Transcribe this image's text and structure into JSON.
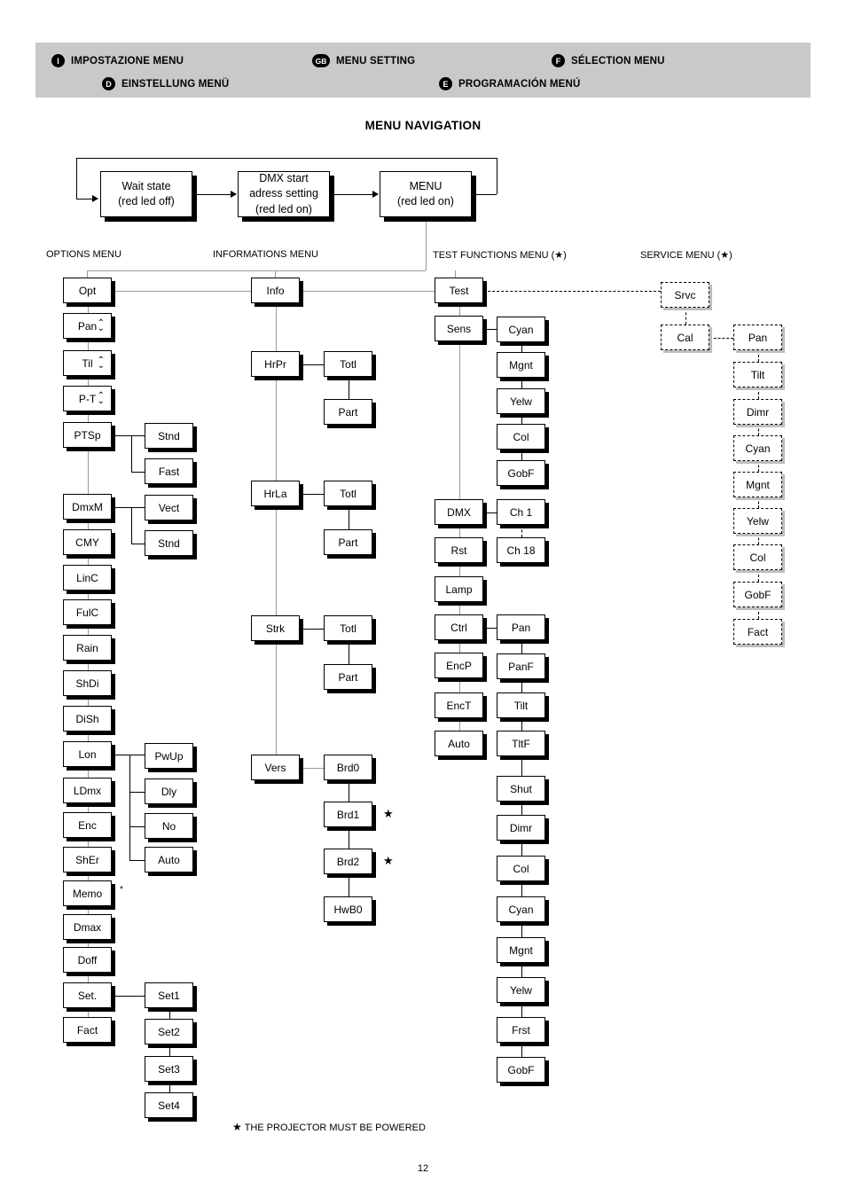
{
  "header": {
    "languages": [
      {
        "badge": "I",
        "label": "IMPOSTAZIONE MENU"
      },
      {
        "badge": "GB",
        "label": "MENU SETTING"
      },
      {
        "badge": "F",
        "label": "SÉLECTION MENU"
      },
      {
        "badge": "D",
        "label": "EINSTELLUNG MENÜ"
      },
      {
        "badge": "E",
        "label": "PROGRAMACIÓN MENÚ"
      }
    ],
    "band_color": "#c9c9c9"
  },
  "title": "MENU NAVIGATION",
  "states": [
    {
      "line1": "Wait state",
      "line2": "(red led off)"
    },
    {
      "line1": "DMX start",
      "line2": "adress setting",
      "line3": "(red led on)"
    },
    {
      "line1": "MENU",
      "line2": "(red led on)"
    }
  ],
  "column_labels": {
    "options": "OPTIONS MENU",
    "informations": "INFORMATIONS MENU",
    "test": "TEST FUNCTIONS MENU (★)",
    "service": "SERVICE MENU (★)"
  },
  "options_menu": {
    "root": "Opt",
    "items": [
      {
        "label": "Pan",
        "arrows": true
      },
      {
        "label": "Til",
        "arrows": true
      },
      {
        "label": "P-T",
        "arrows": true
      },
      {
        "label": "PTSp",
        "children": [
          "Stnd",
          "Fast"
        ]
      },
      {
        "label": "DmxM",
        "children": [
          "Vect",
          "Stnd"
        ]
      },
      {
        "label": "CMY"
      },
      {
        "label": "LinC"
      },
      {
        "label": "FulC"
      },
      {
        "label": "Rain"
      },
      {
        "label": "ShDi"
      },
      {
        "label": "DiSh"
      },
      {
        "label": "Lon",
        "children": [
          "PwUp",
          "Dly",
          "No",
          "Auto"
        ]
      },
      {
        "label": "LDmx"
      },
      {
        "label": "Enc"
      },
      {
        "label": "ShEr"
      },
      {
        "label": "Memo",
        "star": "*"
      },
      {
        "label": "Dmax"
      },
      {
        "label": "Doff"
      },
      {
        "label": "Set.",
        "children": [
          "Set1",
          "Set2",
          "Set3",
          "Set4"
        ]
      },
      {
        "label": "Fact"
      }
    ]
  },
  "informations_menu": {
    "root": "Info",
    "items": [
      {
        "label": "HrPr",
        "children": [
          "Totl",
          "Part"
        ]
      },
      {
        "label": "HrLa",
        "children": [
          "Totl",
          "Part"
        ]
      },
      {
        "label": "Strk",
        "children": [
          "Totl",
          "Part"
        ]
      },
      {
        "label": "Vers",
        "children": [
          "Brd0",
          "Brd1",
          "Brd2",
          "HwB0"
        ],
        "child_stars": [
          "",
          "★",
          "★",
          ""
        ]
      }
    ]
  },
  "test_menu": {
    "root": "Test",
    "items": [
      {
        "label": "Sens",
        "children": [
          "Cyan",
          "Mgnt",
          "Yelw",
          "Col",
          "GobF"
        ]
      },
      {
        "label": "DMX",
        "children": [
          "Ch 1",
          "Ch 18"
        ]
      },
      {
        "label": "Rst"
      },
      {
        "label": "Lamp"
      },
      {
        "label": "Ctrl",
        "children": [
          "Pan",
          "PanF",
          "Tilt",
          "TltF",
          "Shut",
          "Dimr",
          "Col",
          "Cyan",
          "Mgnt",
          "Yelw",
          "Frst",
          "GobF"
        ]
      },
      {
        "label": "EncP"
      },
      {
        "label": "EncT"
      },
      {
        "label": "Auto"
      }
    ]
  },
  "service_menu": {
    "root": "Srvc",
    "items": [
      {
        "label": "Cal",
        "children": [
          "Pan",
          "Tilt",
          "Dimr",
          "Cyan",
          "Mgnt",
          "Yelw",
          "Col",
          "GobF",
          "Fact"
        ]
      }
    ]
  },
  "footnote": {
    "star": "★",
    "text": "THE PROJECTOR MUST BE POWERED"
  },
  "page_number": "12"
}
